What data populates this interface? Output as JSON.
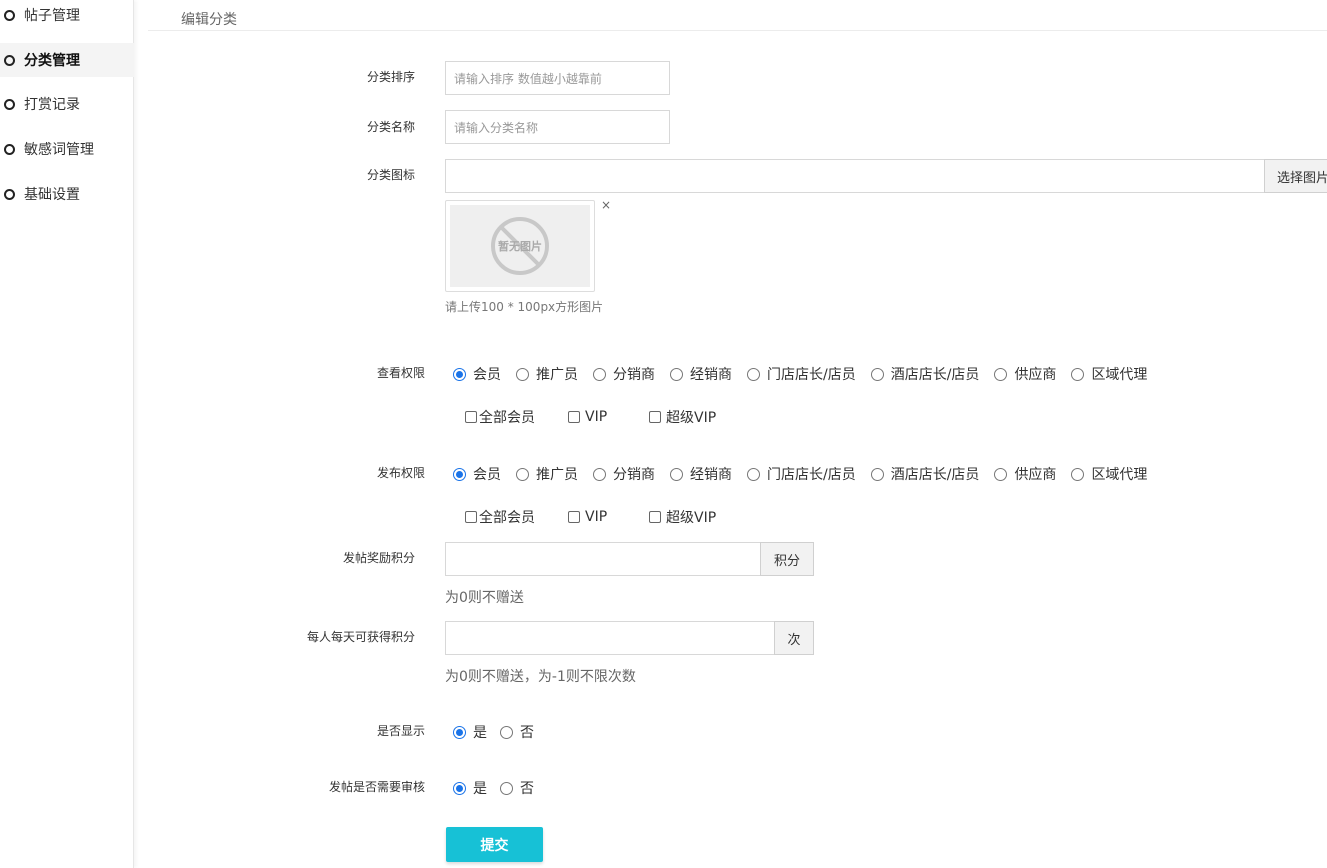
{
  "sidebar": {
    "items": [
      {
        "label": "帖子管理",
        "active": false
      },
      {
        "label": "分类管理",
        "active": true
      },
      {
        "label": "打赏记录",
        "active": false
      },
      {
        "label": "敏感词管理",
        "active": false
      },
      {
        "label": "基础设置",
        "active": false
      }
    ]
  },
  "header": {
    "title": "编辑分类"
  },
  "form": {
    "sort": {
      "label": "分类排序",
      "placeholder": "请输入排序 数值越小越靠前"
    },
    "name": {
      "label": "分类名称",
      "placeholder": "请输入分类名称"
    },
    "icon": {
      "label": "分类图标",
      "value": "",
      "select_button": "选择图片",
      "thumb_text": "暂无图片",
      "remove": "×",
      "hint": "请上传100 * 100px方形图片"
    },
    "view_perm": {
      "label": "查看权限",
      "options": [
        "会员",
        "推广员",
        "分销商",
        "经销商",
        "门店店长/店员",
        "酒店店长/店员",
        "供应商",
        "区域代理"
      ],
      "selected": "会员",
      "levels": [
        "全部会员",
        "VIP",
        "超级VIP"
      ]
    },
    "post_perm": {
      "label": "发布权限",
      "options": [
        "会员",
        "推广员",
        "分销商",
        "经销商",
        "门店店长/店员",
        "酒店店长/店员",
        "供应商",
        "区域代理"
      ],
      "selected": "会员",
      "levels": [
        "全部会员",
        "VIP",
        "超级VIP"
      ]
    },
    "reward": {
      "label": "发帖奖励积分",
      "value": "",
      "addon": "积分",
      "hint": "为0则不赠送"
    },
    "daily": {
      "label": "每人每天可获得积分",
      "value": "",
      "addon": "次",
      "hint": "为0则不赠送，为-1则不限次数"
    },
    "show": {
      "label": "是否显示",
      "yes": "是",
      "no": "否",
      "selected": "是"
    },
    "audit": {
      "label": "发帖是否需要审核",
      "yes": "是",
      "no": "否",
      "selected": "是"
    },
    "submit": "提交"
  },
  "colors": {
    "accent": "#17c1d6",
    "radio": "#1a73e8"
  }
}
